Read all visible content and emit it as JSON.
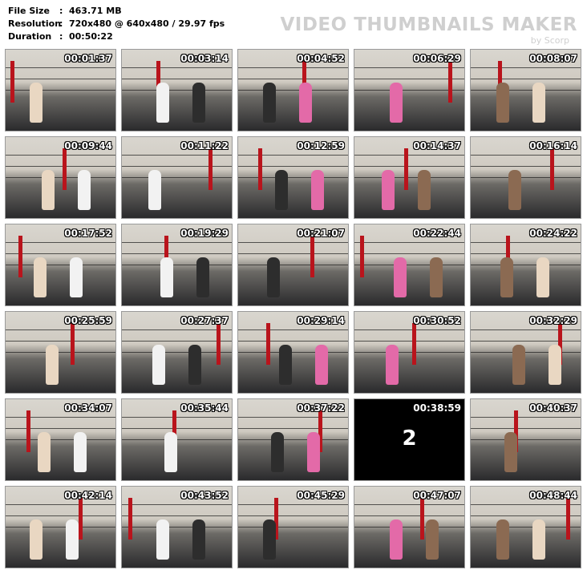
{
  "info": {
    "file_size_label": "File Size",
    "file_size_value": "463.71 MB",
    "resolution_label": "Resolution",
    "resolution_value": "720x480 @ 640x480 / 29.97 fps",
    "duration_label": "Duration",
    "duration_value": "00:50:22",
    "separator": ":"
  },
  "watermark": {
    "title": "VIDEO THUMBNAILS MAKER",
    "subtitle": "by Scorp"
  },
  "thumbnails": [
    {
      "time": "00:01:37"
    },
    {
      "time": "00:03:14"
    },
    {
      "time": "00:04:52"
    },
    {
      "time": "00:06:29"
    },
    {
      "time": "00:08:07"
    },
    {
      "time": "00:09:44"
    },
    {
      "time": "00:11:22"
    },
    {
      "time": "00:12:59"
    },
    {
      "time": "00:14:37"
    },
    {
      "time": "00:16:14"
    },
    {
      "time": "00:17:52"
    },
    {
      "time": "00:19:29"
    },
    {
      "time": "00:21:07"
    },
    {
      "time": "00:22:44"
    },
    {
      "time": "00:24:22"
    },
    {
      "time": "00:25:59"
    },
    {
      "time": "00:27:37"
    },
    {
      "time": "00:29:14"
    },
    {
      "time": "00:30:52"
    },
    {
      "time": "00:32:29"
    },
    {
      "time": "00:34:07"
    },
    {
      "time": "00:35:44"
    },
    {
      "time": "00:37:22"
    },
    {
      "time": "00:38:59",
      "overlay": "2"
    },
    {
      "time": "00:40:37"
    },
    {
      "time": "00:42:14"
    },
    {
      "time": "00:43:52"
    },
    {
      "time": "00:45:29"
    },
    {
      "time": "00:47:07"
    },
    {
      "time": "00:48:44"
    }
  ]
}
